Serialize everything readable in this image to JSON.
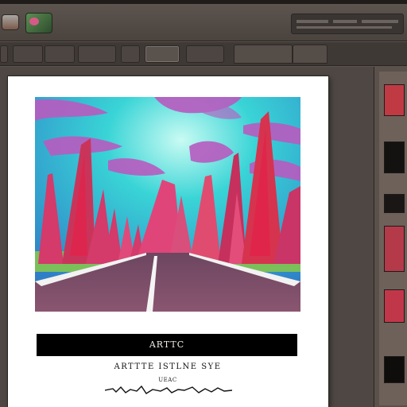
{
  "toolbar": {
    "tabs": [
      "",
      "",
      "",
      "",
      ""
    ],
    "right_tabs": [
      "",
      ""
    ]
  },
  "document": {
    "title": "ARTTC",
    "subtitle": "ARTTTE  ISTLNE  SYE",
    "caption": "UEAC"
  },
  "artwork": {
    "sky_color": "#39d4d6",
    "cloud_color": "#b85bc0",
    "tree_color": "#d43a6a",
    "road_color": "#7e4f68",
    "grass_color": "#7bbf5a"
  },
  "panel": {
    "thumb_colors": [
      "#c03a44",
      "#141210",
      "#1a1615",
      "#b43a4a",
      "#c1374a",
      "#0f0d0c"
    ]
  }
}
